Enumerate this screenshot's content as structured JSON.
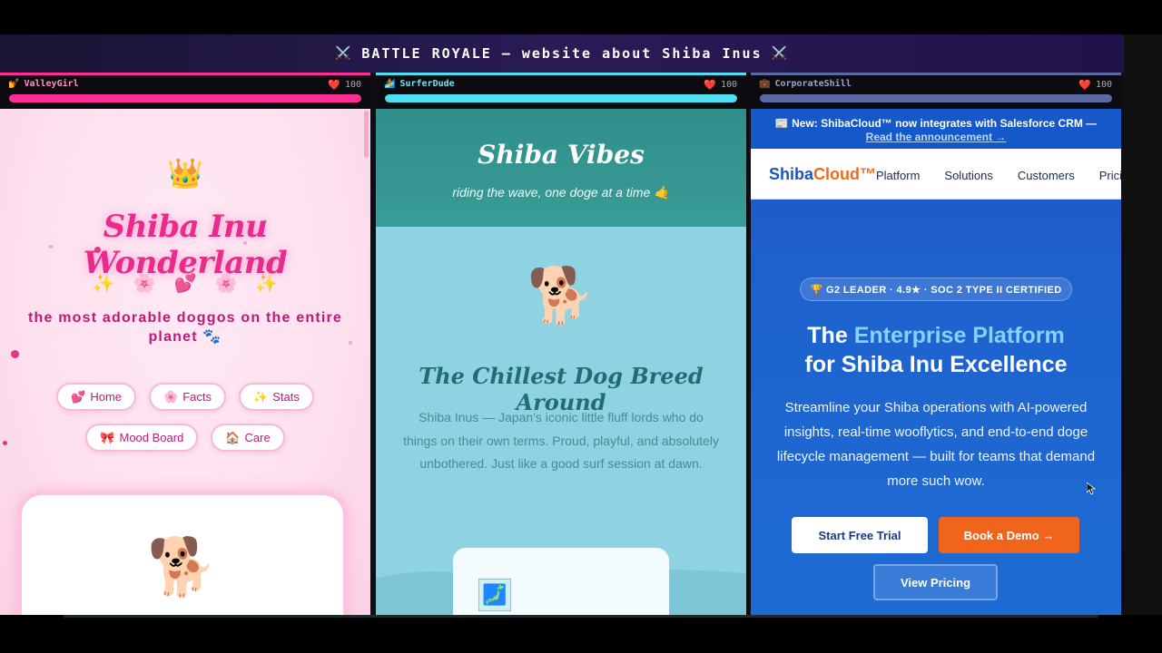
{
  "banner": {
    "left_icon": "⚔️",
    "title": "BATTLE ROYALE — website about Shiba Inus",
    "right_icon": "⚔️"
  },
  "colors": {
    "valleygirl": "#ff2d95",
    "surferdude": "#4ee0f0",
    "corporate": "#5a6aa0",
    "accent_orange": "#f0641c"
  },
  "players": [
    {
      "icon": "💅",
      "name": "ValleyGirl",
      "hp_icon": "❤️",
      "hp": "100",
      "hp_fraction": 1.0
    },
    {
      "icon": "🏄",
      "name": "SurferDude",
      "hp_icon": "❤️",
      "hp": "100",
      "hp_fraction": 1.0
    },
    {
      "icon": "💼",
      "name": "CorporateShill",
      "hp_icon": "❤️",
      "hp": "100",
      "hp_fraction": 1.0
    }
  ],
  "valley": {
    "crown": "👑",
    "title": "Shiba Inu Wonderland",
    "sparkles": [
      "✨",
      "🌸",
      "💕",
      "🌸",
      "✨"
    ],
    "tagline": "the most adorable doggos on the entire planet 🐾",
    "nav": [
      {
        "icon": "💕",
        "label": "Home"
      },
      {
        "icon": "🌸",
        "label": "Facts"
      },
      {
        "icon": "✨",
        "label": "Stats"
      },
      {
        "icon": "🎀",
        "label": "Mood Board"
      },
      {
        "icon": "🏠",
        "label": "Care"
      }
    ],
    "card_dog": "🐕"
  },
  "surfer": {
    "title": "Shiba Vibes",
    "subtitle": "riding the wave, one doge at a time 🤙",
    "dog": "🐕",
    "heading": "The Chillest Dog Breed Around",
    "description": "Shiba Inus — Japan's iconic little fluff lords who do things on their own terms. Proud, playful, and absolutely unbothered. Just like a good surf session at dawn.",
    "card_icon": "🗾"
  },
  "corporate": {
    "announce_icon": "📰",
    "announce_text": "New: ShibaCloud™ now integrates with Salesforce CRM —",
    "announce_link": "Read the announcement →",
    "logo_a": "Shiba",
    "logo_b": "Cloud™",
    "nav": [
      "Platform",
      "Solutions",
      "Customers",
      "Pricing"
    ],
    "badge": "🏆 G2 LEADER · 4.9★ · SOC 2 TYPE II CERTIFIED",
    "heading_pre": "The ",
    "heading_highlight": "Enterprise Platform",
    "heading_post": "for Shiba Inu Excellence",
    "description": "Streamline your Shiba operations with AI-powered insights, real-time wooflytics, and end-to-end doge lifecycle management — built for teams that demand more such wow.",
    "btn_trial": "Start Free Trial",
    "btn_demo": "Book a Demo →",
    "btn_pricing": "View Pricing"
  }
}
